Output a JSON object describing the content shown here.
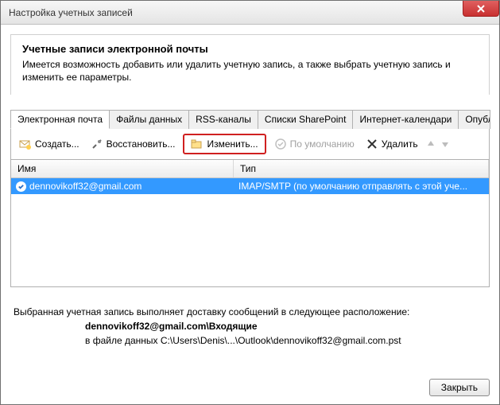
{
  "window": {
    "title": "Настройка учетных записей"
  },
  "header": {
    "title": "Учетные записи электронной почты",
    "desc": "Имеется возможность добавить или удалить учетную запись, а также выбрать учетную запись и изменить ее параметры."
  },
  "tabs": [
    {
      "label": "Электронная почта",
      "active": true
    },
    {
      "label": "Файлы данных"
    },
    {
      "label": "RSS-каналы"
    },
    {
      "label": "Списки SharePoint"
    },
    {
      "label": "Интернет-календари"
    },
    {
      "label": "Опубликован"
    }
  ],
  "toolbar": {
    "create": "Создать...",
    "repair": "Восстановить...",
    "edit": "Изменить...",
    "default": "По умолчанию",
    "delete": "Удалить"
  },
  "list": {
    "col_name": "Имя",
    "col_type": "Тип",
    "rows": [
      {
        "name": "dennovikoff32@gmail.com",
        "type": "IMAP/SMTP (по умолчанию отправлять с этой уче..."
      }
    ]
  },
  "info": {
    "line1": "Выбранная учетная запись выполняет доставку сообщений в следующее расположение:",
    "target": "dennovikoff32@gmail.com\\Входящие",
    "line2": "в файле данных C:\\Users\\Denis\\...\\Outlook\\dennovikoff32@gmail.com.pst"
  },
  "footer": {
    "close": "Закрыть"
  }
}
